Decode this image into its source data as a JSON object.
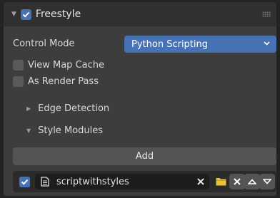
{
  "header": {
    "title": "Freestyle",
    "expanded": true,
    "enabled": true
  },
  "control_mode": {
    "label": "Control Mode",
    "value": "Python Scripting"
  },
  "checkboxes": [
    {
      "label": "View Map Cache",
      "checked": false
    },
    {
      "label": "As Render Pass",
      "checked": false
    }
  ],
  "subpanels": [
    {
      "label": "Edge Detection",
      "expanded": false
    },
    {
      "label": "Style Modules",
      "expanded": true
    }
  ],
  "add_button": {
    "label": "Add"
  },
  "modules": [
    {
      "enabled": true,
      "filename": "scriptwithstyles"
    }
  ],
  "colors": {
    "accent": "#4772b3",
    "panel_bg": "#3d3d3d",
    "header_bg": "#303030",
    "folder": "#e8c23f"
  },
  "icons": [
    "disclosure-triangle-icon",
    "checkbox-icon",
    "drag-grip-icon",
    "chevron-down-icon",
    "text-document-icon",
    "clear-x-icon",
    "folder-icon",
    "delete-x-icon",
    "move-up-icon",
    "move-down-icon"
  ]
}
